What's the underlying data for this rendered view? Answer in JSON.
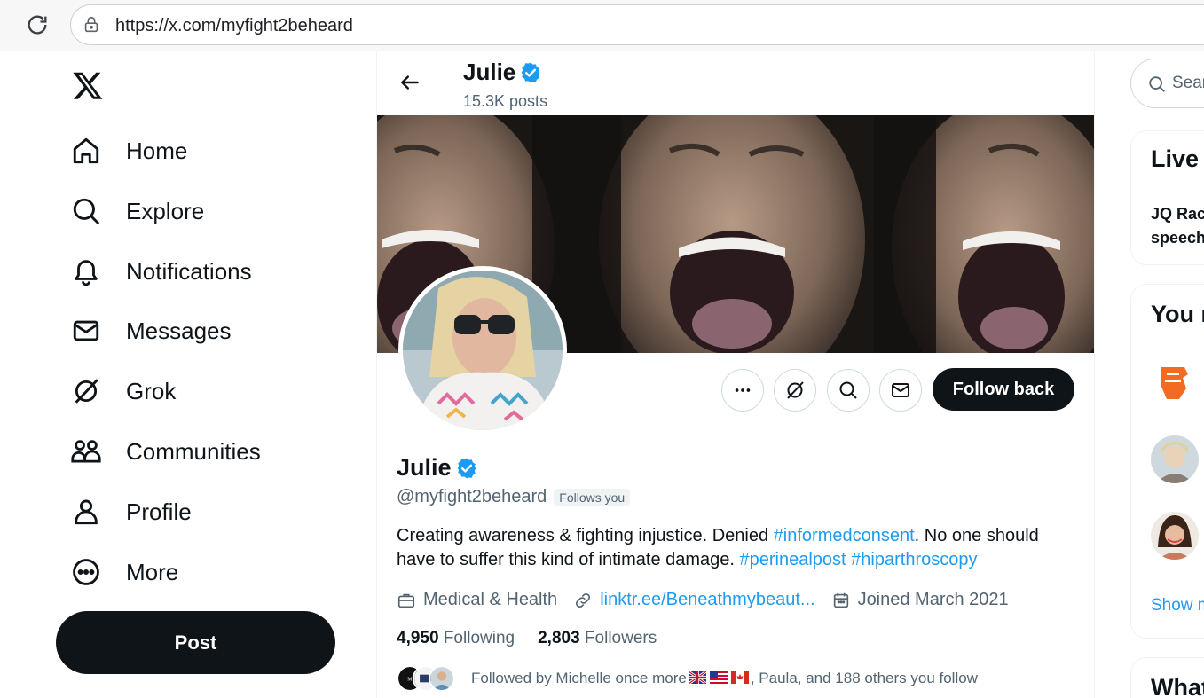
{
  "browser": {
    "url": "https://x.com/myfight2beheard",
    "icons": {
      "reload": "reload-icon",
      "lock": "lock-icon"
    }
  },
  "nav": {
    "logo": "x-logo-icon",
    "items": [
      {
        "label": "Home",
        "icon": "home-icon"
      },
      {
        "label": "Explore",
        "icon": "search-icon"
      },
      {
        "label": "Notifications",
        "icon": "bell-icon"
      },
      {
        "label": "Messages",
        "icon": "mail-icon"
      },
      {
        "label": "Grok",
        "icon": "grok-icon"
      },
      {
        "label": "Communities",
        "icon": "communities-icon"
      },
      {
        "label": "Profile",
        "icon": "person-icon"
      },
      {
        "label": "More",
        "icon": "more-circle-icon"
      }
    ],
    "post_label": "Post"
  },
  "header": {
    "name": "Julie",
    "posts": "15.3K posts"
  },
  "profile": {
    "name": "Julie",
    "handle": "@myfight2beheard",
    "follows_you": "Follows you",
    "bio_text_1": "Creating awareness & fighting injustice. Denied ",
    "bio_tag_1": "#informedconsent",
    "bio_text_2": ". No one should have to suffer this kind of intimate damage. ",
    "bio_tag_2": "#perinealpost",
    "bio_tag_3": "#hiparthroscopy",
    "category": "Medical & Health",
    "link": "linktr.ee/Beneathmybeaut...",
    "joined": "Joined March 2021",
    "following_count": "4,950",
    "following_label": "Following",
    "followers_count": "2,803",
    "followers_label": "Followers",
    "followed_by_1": "Followed by Michelle once more",
    "followed_by_2": ", Paula, and 188 others you follow",
    "follow_back_label": "Follow back"
  },
  "right": {
    "search_placeholder": "Sear",
    "live_title": "Live o",
    "live_text_1": "JQ Rac",
    "live_text_2": "speech",
    "you_title": "You m",
    "show_more": "Show m",
    "what_title": "What"
  },
  "colors": {
    "accent": "#1d9bf0",
    "text": "#0f1419",
    "muted": "#536471",
    "button_dark": "#0f1419"
  }
}
